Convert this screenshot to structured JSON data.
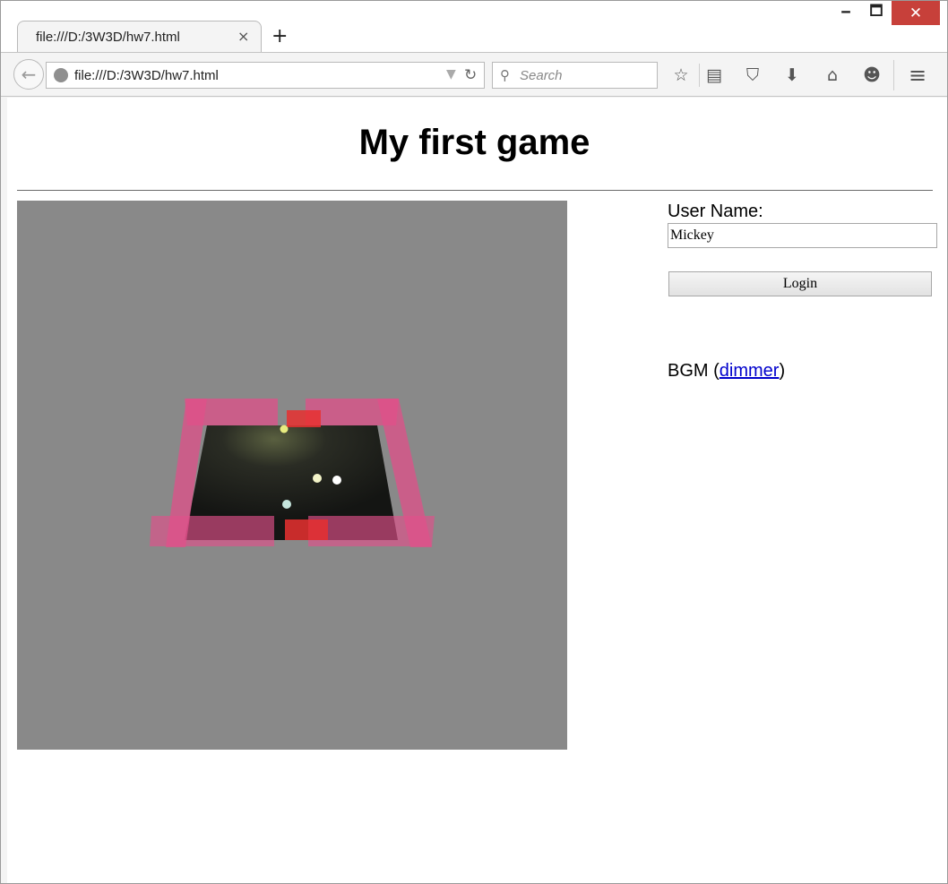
{
  "window": {
    "minimize_glyph": "🗕",
    "maximize_glyph": "🗖",
    "close_glyph": "✕"
  },
  "tab": {
    "title": "file:///D:/3W3D/hw7.html",
    "close_glyph": "×",
    "new_tab_glyph": "+"
  },
  "nav": {
    "back_glyph": "←",
    "url": "file:///D:/3W3D/hw7.html",
    "dropdown_glyph": "▼",
    "reload_glyph": "↻",
    "search_placeholder": "Search",
    "search_glyph": "⚲",
    "icons": {
      "bookmark": "☆",
      "reading_list": "▤",
      "pocket": "⛉",
      "download": "⬇",
      "home": "⌂",
      "chat": "☻",
      "menu": "≡"
    }
  },
  "page": {
    "title": "My first game",
    "username_label": "User Name:",
    "username_value": "Mickey",
    "login_label": "Login",
    "bgm_prefix": "BGM (",
    "bgm_link": "dimmer",
    "bgm_suffix": ")"
  },
  "colors": {
    "canvas_bg": "#898989",
    "table_surface": "#1e1f1c",
    "wall_pink": "#e0508a",
    "goal_red": "#e83030",
    "close_button": "#c7403a"
  }
}
